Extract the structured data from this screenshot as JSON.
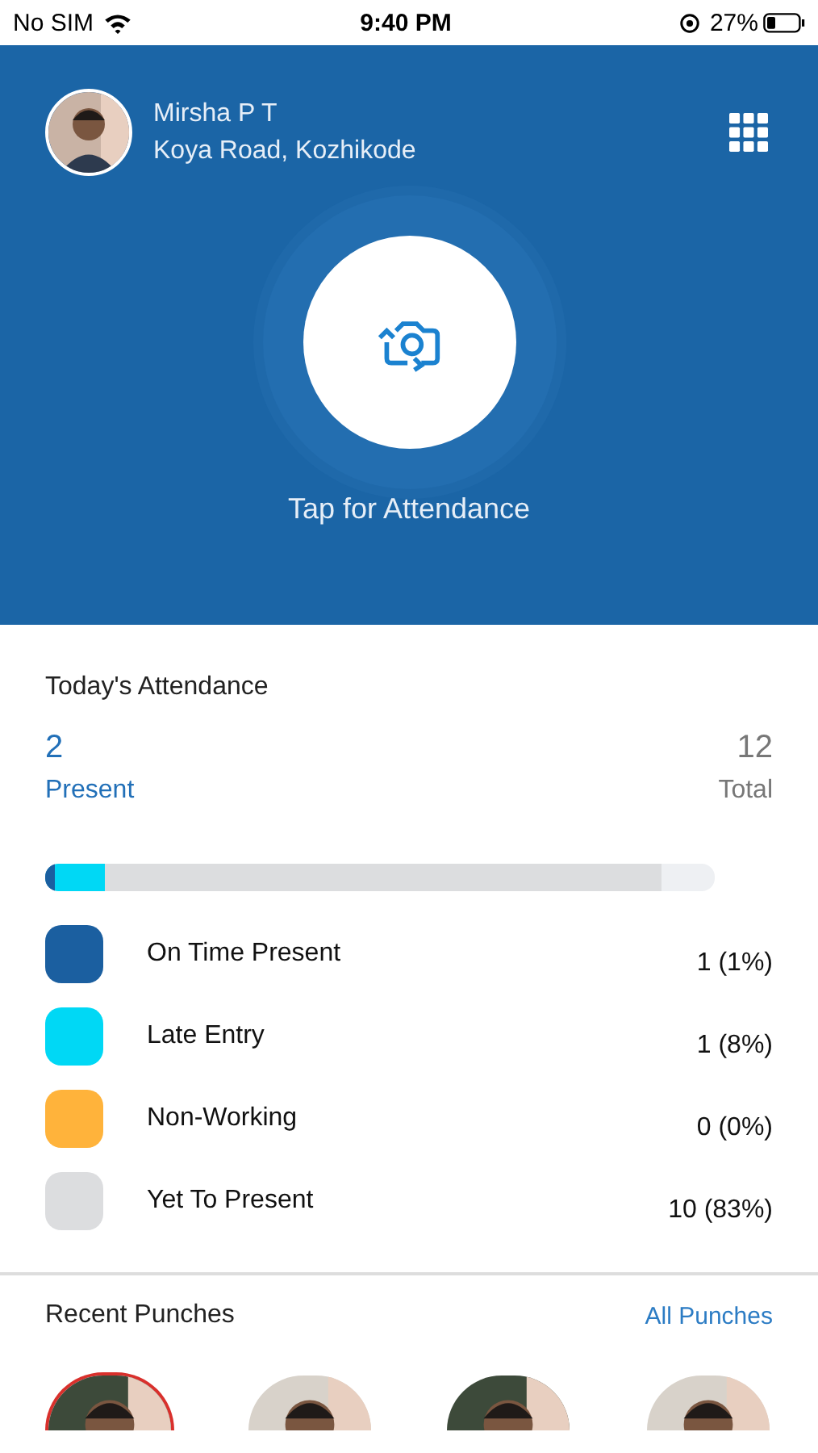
{
  "status_bar": {
    "carrier": "No SIM",
    "time": "9:40 PM",
    "battery": "27%"
  },
  "profile": {
    "name": "Mirsha P T",
    "location": "Koya Road, Kozhikode"
  },
  "attendance_button": {
    "label": "Tap for Attendance"
  },
  "today": {
    "title": "Today's Attendance",
    "present_count": "2",
    "present_label": "Present",
    "total_count": "12",
    "total_label": "Total",
    "categories": [
      {
        "label": "On Time Present",
        "value": "1 (1%)",
        "color": "#1b5fa0",
        "level": 0.015
      },
      {
        "label": "Late Entry",
        "value": "1 (8%)",
        "color": "#00d8f5",
        "level": 0.09
      },
      {
        "label": "Non-Working",
        "value": "0 (0%)",
        "color": "#ffb33b",
        "level": 0
      },
      {
        "label": "Yet To Present",
        "value": "10 (83%)",
        "color": "#dcdddf",
        "level": 0.92
      }
    ]
  },
  "recent_punches": {
    "title": "Recent Punches",
    "link": "All Punches",
    "punches": [
      {
        "kind": "picture",
        "highlighted": true
      },
      {
        "kind": "picture",
        "highlighted": false
      },
      {
        "kind": "picture",
        "highlighted": false
      },
      {
        "kind": "picture",
        "highlighted": false
      }
    ]
  }
}
